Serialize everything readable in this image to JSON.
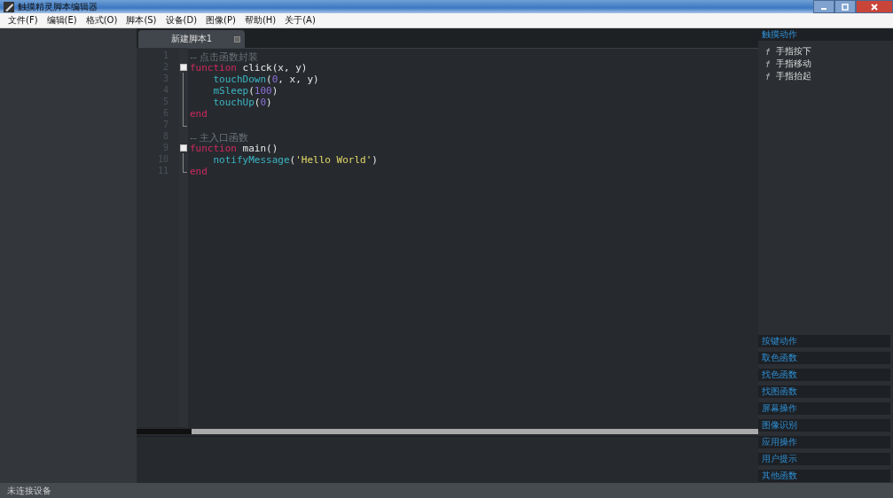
{
  "window": {
    "title": "触摸精灵脚本编辑器"
  },
  "menu": [
    "文件(F)",
    "编辑(E)",
    "格式(O)",
    "脚本(S)",
    "设备(D)",
    "图像(P)",
    "帮助(H)",
    "关于(A)"
  ],
  "tabs": [
    {
      "label": "新建脚本1",
      "selected": true
    }
  ],
  "editor": {
    "lines": [
      {
        "number": "1",
        "kind": "plain",
        "tokens": [
          {
            "kind": "comment",
            "text": "-- 点击函数封装"
          }
        ]
      },
      {
        "number": "2",
        "kind": "start",
        "tokens": [
          {
            "kind": "keyword",
            "text": "function"
          },
          {
            "kind": "plain",
            "text": " click(x, y)"
          }
        ]
      },
      {
        "number": "3",
        "kind": "body",
        "indented": true,
        "tokens": [
          {
            "kind": "func",
            "text": "touchDown"
          },
          {
            "kind": "plain",
            "text": "("
          },
          {
            "kind": "number",
            "text": "0"
          },
          {
            "kind": "plain",
            "text": ", x, y)"
          }
        ]
      },
      {
        "number": "4",
        "kind": "body",
        "indented": true,
        "tokens": [
          {
            "kind": "func",
            "text": "mSleep"
          },
          {
            "kind": "plain",
            "text": "("
          },
          {
            "kind": "number",
            "text": "100"
          },
          {
            "kind": "plain",
            "text": ")"
          }
        ]
      },
      {
        "number": "5",
        "kind": "body",
        "indented": true,
        "tokens": [
          {
            "kind": "func",
            "text": "touchUp"
          },
          {
            "kind": "plain",
            "text": "("
          },
          {
            "kind": "number",
            "text": "0"
          },
          {
            "kind": "plain",
            "text": ")"
          }
        ]
      },
      {
        "number": "6",
        "kind": "body",
        "tokens": [
          {
            "kind": "keyword",
            "text": "end"
          }
        ]
      },
      {
        "number": "7",
        "kind": "end"
      },
      {
        "number": "8",
        "kind": "plain",
        "tokens": [
          {
            "kind": "comment",
            "text": "-- 主入口函数"
          }
        ]
      },
      {
        "number": "9",
        "kind": "start",
        "tokens": [
          {
            "kind": "keyword",
            "text": "function"
          },
          {
            "kind": "plain",
            "text": " main()"
          }
        ]
      },
      {
        "number": "10",
        "kind": "body",
        "indented": true,
        "tokens": [
          {
            "kind": "func",
            "text": "notifyMessage"
          },
          {
            "kind": "plain",
            "text": "("
          },
          {
            "kind": "string",
            "text": "'Hello World'"
          },
          {
            "kind": "plain",
            "text": ")"
          }
        ]
      },
      {
        "number": "11",
        "kind": "end",
        "tokens": [
          {
            "kind": "keyword",
            "text": "end"
          }
        ]
      }
    ]
  },
  "functions_panel": {
    "header": "触摸动作",
    "items": [
      "手指按下",
      "手指移动",
      "手指抬起"
    ],
    "categories": [
      "按键动作",
      "取色函数",
      "找色函数",
      "找图函数",
      "屏幕操作",
      "图像识别",
      "应用操作",
      "用户提示",
      "其他函数"
    ]
  },
  "status_bar": {
    "text": "未连接设备"
  }
}
